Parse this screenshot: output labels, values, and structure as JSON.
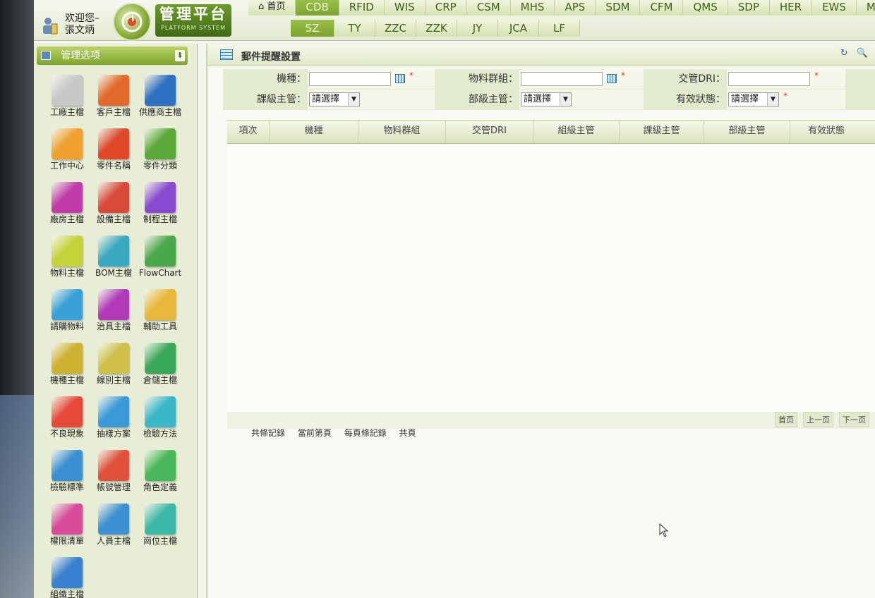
{
  "header": {
    "welcome_line1": "欢迎您–",
    "welcome_line2": "張文炳",
    "logo_title": "管理平台",
    "logo_subtitle": "PLATFORM SYSTEM",
    "top_tabs": [
      "首页",
      "CDB",
      "RFID",
      "WIS",
      "CRP",
      "CSM",
      "MHS",
      "APS",
      "SDM",
      "CFM",
      "QMS",
      "SDP",
      "HER",
      "EWS",
      "MRP"
    ],
    "active_top_tab": "CDB",
    "sub_tabs": [
      "SZ",
      "TY",
      "ZZC",
      "ZZK",
      "JY",
      "JCA",
      "LF"
    ],
    "active_sub_tab": "SZ"
  },
  "sidebar": {
    "title": "管理选项",
    "collapse_label": "⬇",
    "modules": [
      {
        "label": "工廠主檔",
        "icon": "factory-icon",
        "color": "#c8c8c8"
      },
      {
        "label": "客戶主檔",
        "icon": "handshake-icon",
        "color": "#e36a2a"
      },
      {
        "label": "供應商主檔",
        "icon": "supplier-icon",
        "color": "#2d6fc0"
      },
      {
        "label": "工作中心",
        "icon": "workstation-icon",
        "color": "#f0a030"
      },
      {
        "label": "零件名稱",
        "icon": "gears-icon",
        "color": "#e04828"
      },
      {
        "label": "零件分類",
        "icon": "gear-grid-icon",
        "color": "#5aa83a"
      },
      {
        "label": "廠房主檔",
        "icon": "building-icon",
        "color": "#c03aa8"
      },
      {
        "label": "設備主檔",
        "icon": "machine-icon",
        "color": "#d84a3a"
      },
      {
        "label": "制程主檔",
        "icon": "process-icon",
        "color": "#8a4ad0"
      },
      {
        "label": "物料主檔",
        "icon": "cart-icon",
        "color": "#c6d23a"
      },
      {
        "label": "BOM主檔",
        "icon": "bom-icon",
        "color": "#3aa8c0"
      },
      {
        "label": "FlowChart",
        "icon": "flowchart-icon",
        "color": "#4aa84a"
      },
      {
        "label": "請購物料",
        "icon": "box-icon",
        "color": "#3aa0d8"
      },
      {
        "label": "治具主檔",
        "icon": "jig-icon",
        "color": "#b03ab8"
      },
      {
        "label": "輔助工具",
        "icon": "tools-icon",
        "color": "#e8b83a"
      },
      {
        "label": "機種主檔",
        "icon": "model-icon",
        "color": "#d0b030"
      },
      {
        "label": "線別主檔",
        "icon": "line-icon",
        "color": "#d0c048"
      },
      {
        "label": "倉儲主檔",
        "icon": "warehouse-icon",
        "color": "#3aa85a"
      },
      {
        "label": "不良現象",
        "icon": "warning-icon",
        "color": "#e84a3a"
      },
      {
        "label": "抽樣方案",
        "icon": "microscope-icon",
        "color": "#3a9ad8"
      },
      {
        "label": "檢驗方法",
        "icon": "inspect-icon",
        "color": "#3ab8c8"
      },
      {
        "label": "檢驗標準",
        "icon": "scale-icon",
        "color": "#3a90d0"
      },
      {
        "label": "帳號管理",
        "icon": "account-icon",
        "color": "#e0503a"
      },
      {
        "label": "角色定義",
        "icon": "roles-icon",
        "color": "#4ab85a"
      },
      {
        "label": "權限清單",
        "icon": "permission-icon",
        "color": "#d84a9a"
      },
      {
        "label": "人員主檔",
        "icon": "people-icon",
        "color": "#3a90d0"
      },
      {
        "label": "崗位主檔",
        "icon": "post-icon",
        "color": "#3ab8a8"
      },
      {
        "label": "組織主檔",
        "icon": "org-icon",
        "color": "#3a80d0"
      }
    ]
  },
  "panel": {
    "title": "郵件提醒設置",
    "tools_label": "↻ 🔍"
  },
  "form": {
    "model_label": "機種：",
    "material_group_label": "物料群組：",
    "dri_label": "交管DRI：",
    "section_manager_label": "課級主管：",
    "dept_manager_label": "部級主管：",
    "status_label": "有效狀態：",
    "model_value": "",
    "material_group_value": "",
    "dri_value": "",
    "select_placeholder": "請選擇",
    "required_mark": "*"
  },
  "grid": {
    "columns": [
      "項次",
      "機種",
      "物料群組",
      "交管DRI",
      "組級主管",
      "課級主管",
      "部級主管",
      "有效狀態"
    ]
  },
  "pager": {
    "info": [
      "共條記錄",
      "當前第頁",
      "每頁條記錄",
      "共頁"
    ],
    "buttons": [
      "首页",
      "上一页",
      "下一页"
    ]
  }
}
